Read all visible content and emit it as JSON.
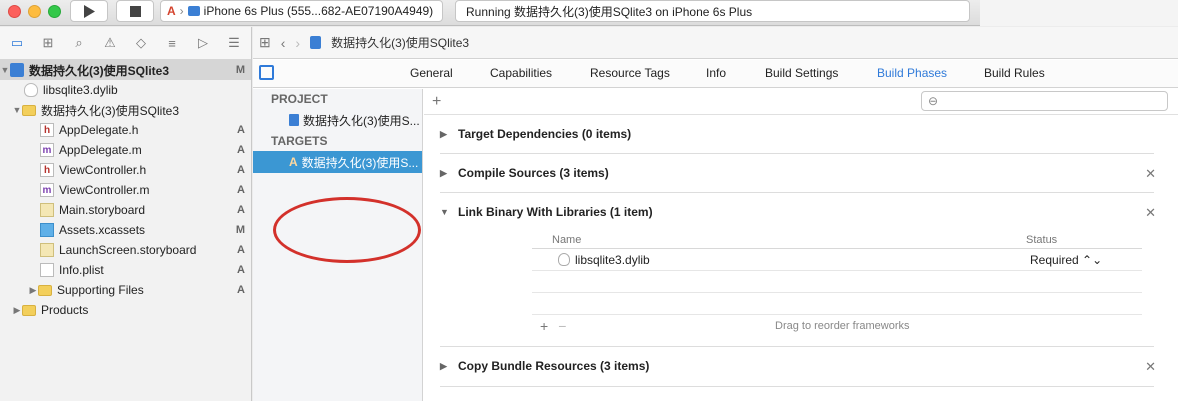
{
  "toolbar": {
    "scheme_device": "iPhone 6s Plus (555...682-AE07190A4949)",
    "activity": "Running 数据持久化(3)使用SQlite3 on iPhone 6s Plus"
  },
  "navigator": {
    "project_name": "数据持久化(3)使用SQlite3",
    "project_status": "M",
    "items": [
      {
        "label": "libsqlite3.dylib",
        "status": ""
      },
      {
        "label": "数据持久化(3)使用SQlite3",
        "status": ""
      },
      {
        "label": "AppDelegate.h",
        "status": "A"
      },
      {
        "label": "AppDelegate.m",
        "status": "A"
      },
      {
        "label": "ViewController.h",
        "status": "A"
      },
      {
        "label": "ViewController.m",
        "status": "A"
      },
      {
        "label": "Main.storyboard",
        "status": "A"
      },
      {
        "label": "Assets.xcassets",
        "status": "M"
      },
      {
        "label": "LaunchScreen.storyboard",
        "status": "A"
      },
      {
        "label": "Info.plist",
        "status": "A"
      },
      {
        "label": "Supporting Files",
        "status": "A"
      },
      {
        "label": "Products",
        "status": ""
      }
    ]
  },
  "jumpbar": {
    "crumb": "数据持久化(3)使用SQlite3"
  },
  "tabs": [
    "General",
    "Capabilities",
    "Resource Tags",
    "Info",
    "Build Settings",
    "Build Phases",
    "Build Rules"
  ],
  "targets_panel": {
    "project_header": "PROJECT",
    "project_item": "数据持久化(3)使用S...",
    "targets_header": "TARGETS",
    "target_item": "数据持久化(3)使用S..."
  },
  "phases": {
    "add": "+",
    "items": [
      "Target Dependencies (0 items)",
      "Compile Sources (3 items)",
      "Link Binary With Libraries (1 item)",
      "Copy Bundle Resources (3 items)"
    ],
    "lib_table": {
      "col_name": "Name",
      "col_status": "Status",
      "row_name": "libsqlite3.dylib",
      "row_status": "Required ⌃⌄",
      "footer_hint": "Drag to reorder frameworks"
    }
  },
  "colors": {
    "accent": "#2f7ad9",
    "selection": "#3b97d3",
    "annotation": "#d3312b"
  }
}
